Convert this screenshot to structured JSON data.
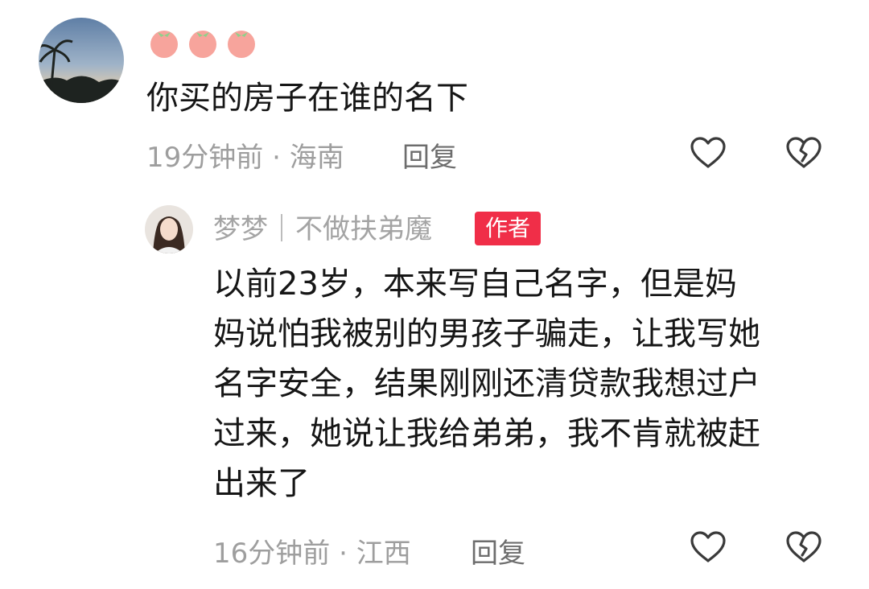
{
  "comment": {
    "username_emoji": "🍅🍅🍅",
    "text": "你买的房子在谁的名下",
    "time": "19分钟前",
    "separator": "·",
    "location": "海南",
    "reply_label": "回复",
    "like_icon": "heart-outline-icon",
    "dislike_icon": "broken-heart-icon"
  },
  "reply": {
    "username": "梦梦｜不做扶弟魔",
    "badge": "作者",
    "lines": [
      "以前23岁，本来写自己名字，但是妈",
      "妈说怕我被别的男孩子骗走，让我写她",
      "名字安全，结果刚刚还清贷款我想过户",
      "过来，她说让我给弟弟，我不肯就被赶",
      "出来了"
    ],
    "time": "16分钟前",
    "separator": "·",
    "location": "江西",
    "reply_label": "回复",
    "like_icon": "heart-outline-icon",
    "dislike_icon": "broken-heart-icon"
  },
  "colors": {
    "badge_bg": "#f02e48",
    "meta_text": "#9e9e9e",
    "icon_stroke": "#3a3a3a"
  }
}
